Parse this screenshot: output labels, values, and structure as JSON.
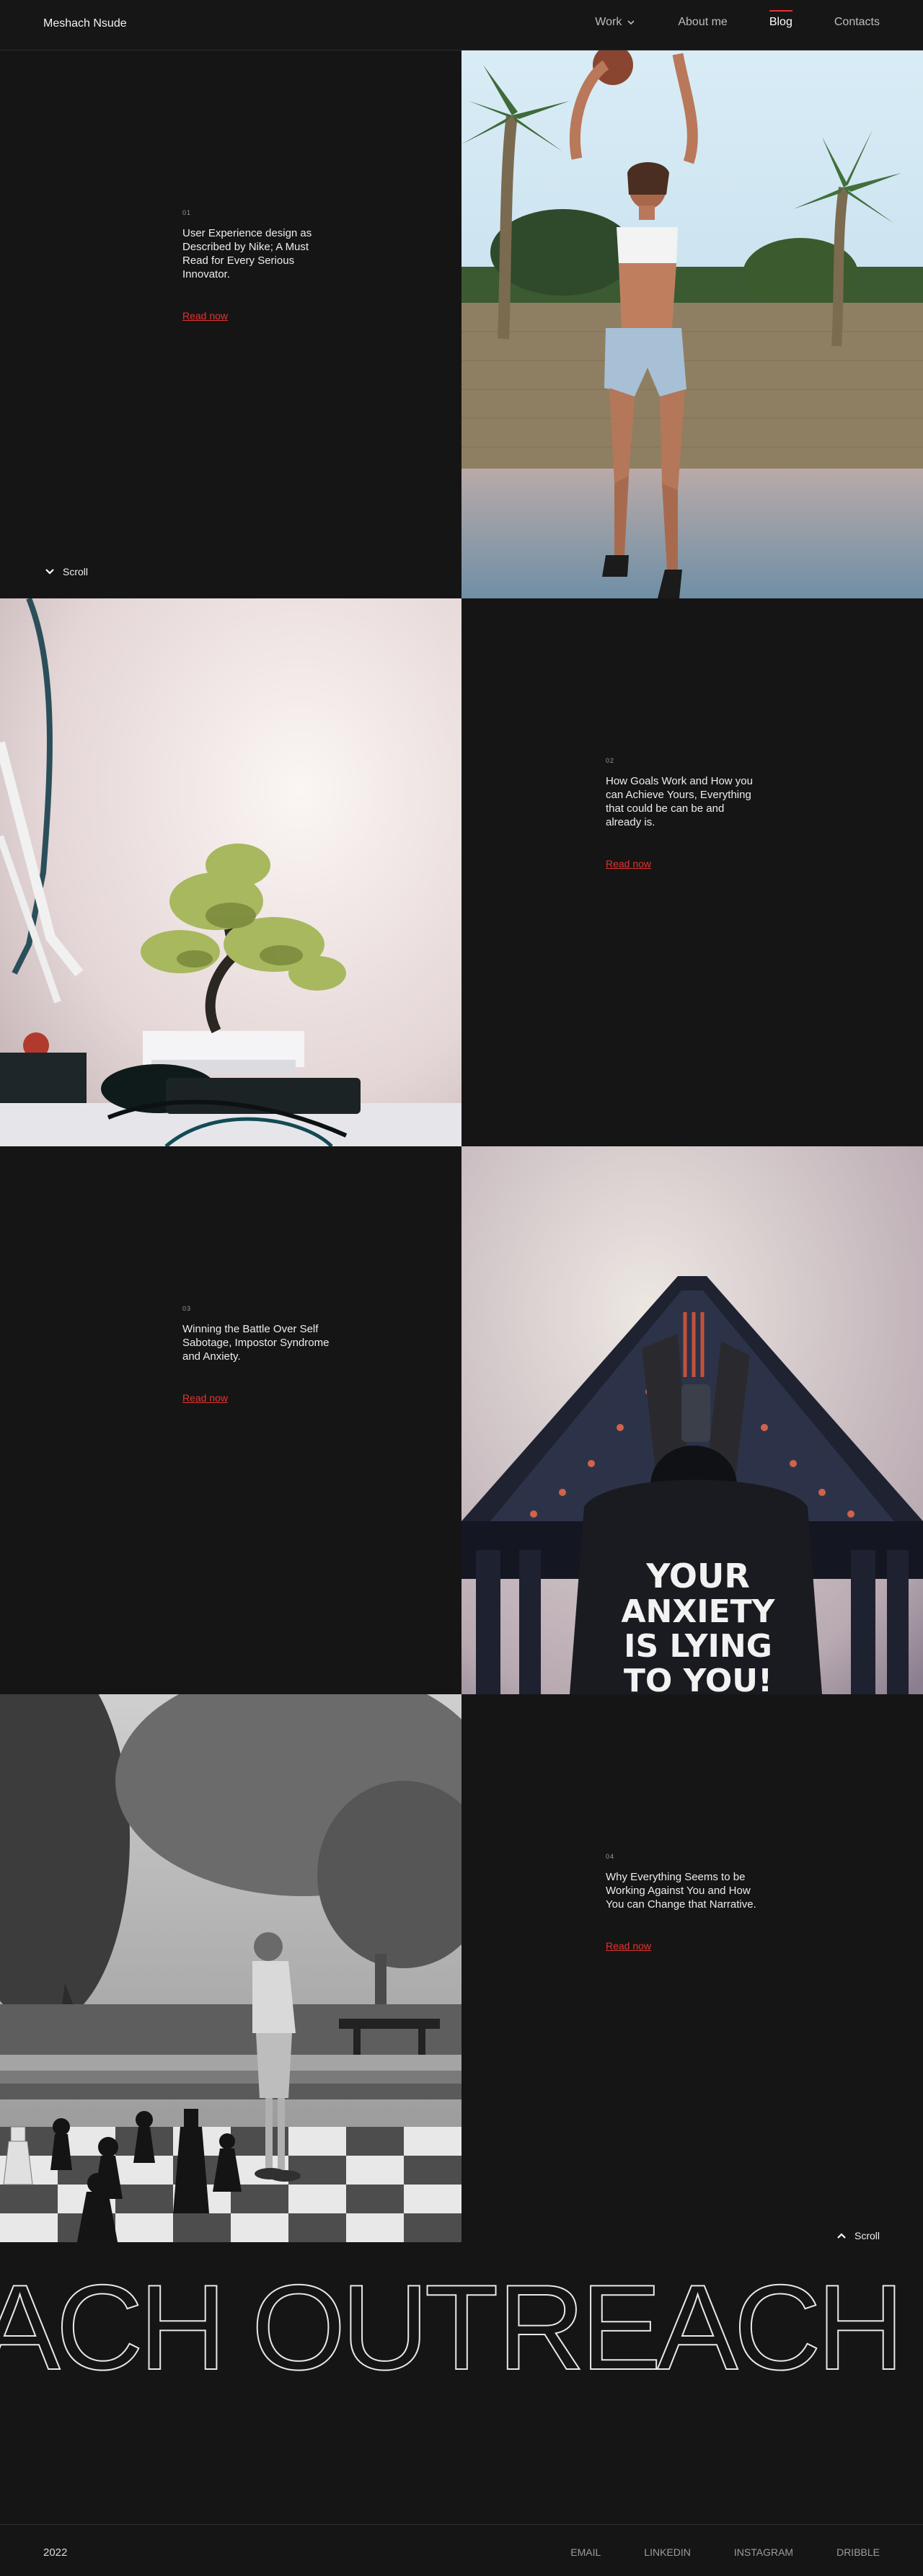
{
  "nav": {
    "brand": "Meshach Nsude",
    "items": [
      {
        "label": "Work"
      },
      {
        "label": "About me"
      },
      {
        "label": "Blog"
      },
      {
        "label": "Contacts"
      }
    ]
  },
  "posts": [
    {
      "number": "01",
      "title": "User Experience design as Described by Nike; A Must Read for Every Serious Innovator.",
      "cta": "Read now"
    },
    {
      "number": "02",
      "title": "How Goals Work and How you can Achieve Yours, Everything that could be can be and already is.",
      "cta": "Read now"
    },
    {
      "number": "03",
      "title": "Winning the Battle Over Self Sabotage, Impostor Syndrome and Anxiety.",
      "cta": "Read now"
    },
    {
      "number": "04",
      "title": "Why Everything Seems to be Working Against You and How You can Change that Narrative.",
      "cta": "Read now"
    }
  ],
  "scroll_label": "Scroll",
  "shirt_text": [
    "YOUR",
    "ANXIETY",
    "IS LYING",
    "TO YOU!"
  ],
  "marquee": "REACH OUT",
  "footer": {
    "year": "2022",
    "links": [
      "EMAIL",
      "LINKEDIN",
      "INSTAGRAM",
      "DRIBBLE"
    ]
  },
  "colors": {
    "accent": "#e3342f",
    "background": "#151515"
  }
}
